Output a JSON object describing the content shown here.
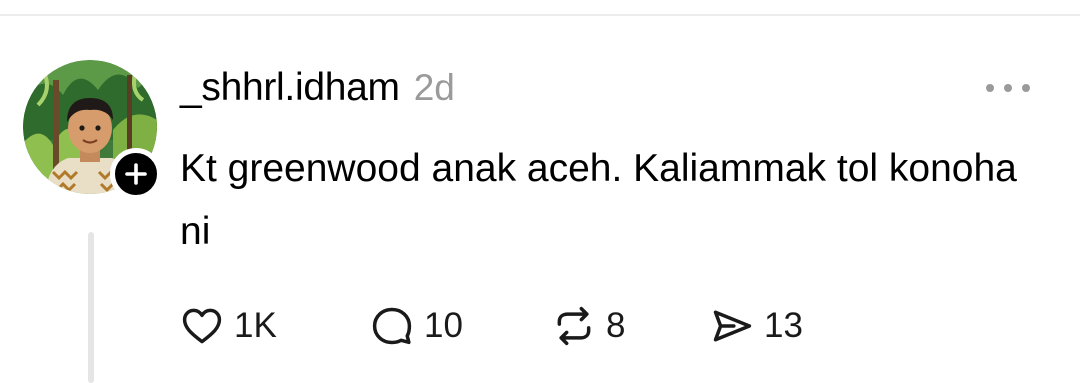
{
  "post": {
    "username": "_shhrl.idham",
    "timestamp": "2d",
    "text": "Kt greenwood anak aceh. Kaliammak tol konoha ni",
    "avatar_icon": "avatar-illustration",
    "follow_icon": "plus-icon",
    "more_icon": "more-horizontal-icon"
  },
  "actions": {
    "like": {
      "icon": "heart-icon",
      "count": "1K"
    },
    "reply": {
      "icon": "comment-icon",
      "count": "10"
    },
    "repost": {
      "icon": "repost-icon",
      "count": "8"
    },
    "share": {
      "icon": "send-icon",
      "count": "13"
    }
  },
  "colors": {
    "text": "#000000",
    "muted": "#9a9a9a",
    "thread_line": "#e5e5e5",
    "badge": "#000000"
  }
}
